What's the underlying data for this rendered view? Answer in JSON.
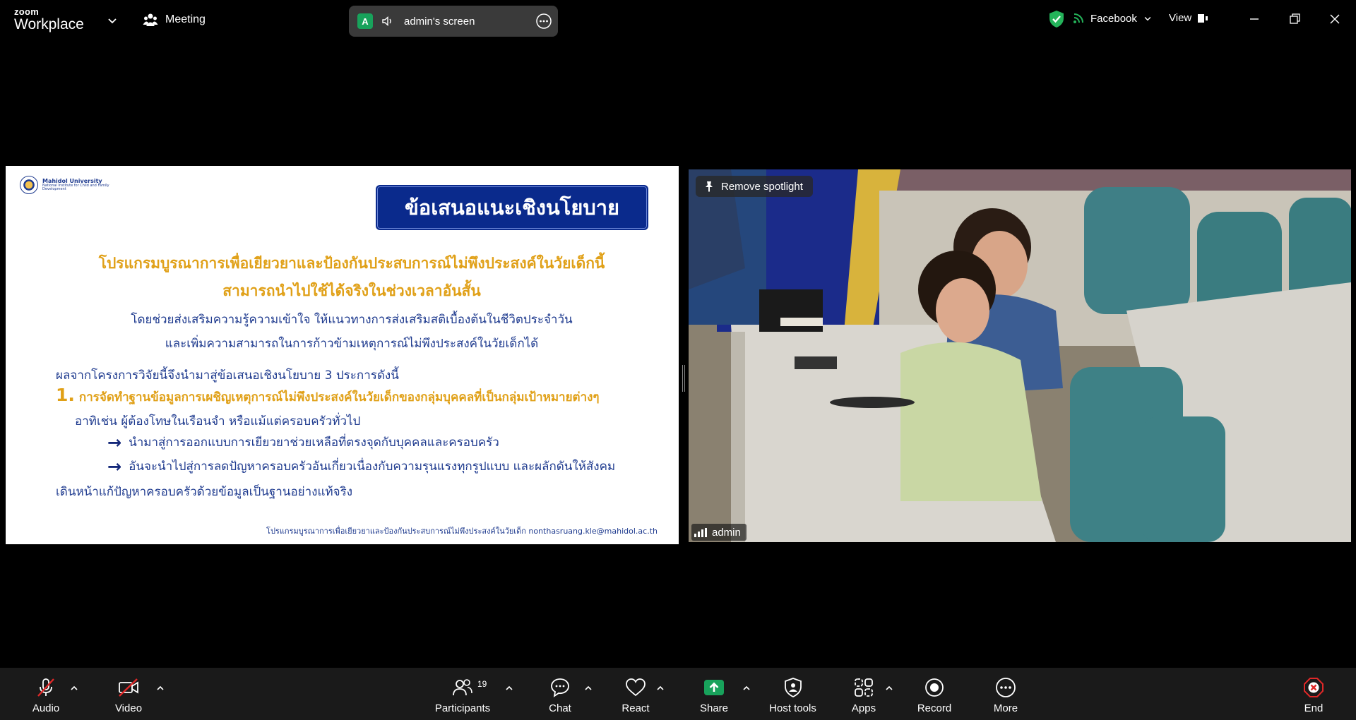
{
  "app": {
    "logo_small": "zoom",
    "logo_large": "Workplace",
    "meeting_label": "Meeting"
  },
  "share_indicator": {
    "avatar_letter": "A",
    "label": "admin's screen"
  },
  "top_right": {
    "feed_label": "Facebook",
    "view_label": "View"
  },
  "slide": {
    "university": "Mahidol University",
    "institute": "National Institute for Child and Family Development",
    "banner": "ข้อเสนอแนะเชิงนโยบาย",
    "heading_1": "โปรแกรมบูรณาการเพื่อเยียวยาและป้องกันประสบการณ์ไม่พึงประสงค์ในวัยเด็กนี้",
    "heading_2": "สามารถนำไปใช้ได้จริงในช่วงเวลาอันสั้น",
    "sub_1": "โดยช่วยส่งเสริมความรู้ความเข้าใจ  ให้แนวทางการส่งเสริมสติเบื้องต้นในชีวิตประจำวัน",
    "sub_2": "และเพิ่มความสามารถในการก้าวข้ามเหตุการณ์ไม่พึงประสงค์ในวัยเด็กได้",
    "intro": "ผลจากโครงการวิจัยนี้จึงนำมาสู่ข้อเสนอเชิงนโยบาย 3 ประการดังนี้",
    "item_number": "1.",
    "item_1": "การจัดทำฐานข้อมูลการเผชิญเหตุการณ์ไม่พึงประสงค์ในวัยเด็กของกลุ่มบุคคลที่เป็นกลุ่มเป้าหมายต่างๆ",
    "item_1_cont": "อาทิเช่น ผู้ต้องโทษในเรือนจำ หรือแม้แต่ครอบครัวทั่วไป",
    "arrow_1": "นำมาสู่การออกแบบการเยียวยาช่วยเหลือที่ตรงจุดกับบุคคลและครอบครัว",
    "arrow_2": "อันจะนำไปสู่การลดปัญหาครอบครัวอันเกี่ยวเนื่องกับความรุนแรงทุกรูปแบบ  และผลักดันให้สังคม",
    "arrow_2_cont": "เดินหน้าแก้ปัญหาครอบครัวด้วยข้อมูลเป็นฐานอย่างแท้จริง",
    "footer": "โปรแกรมบูรณาการเพื่อเยียวยาและป้องกันประสบการณ์ไม่พึงประสงค์ในวัยเด็ก nonthasruang.kle@mahidol.ac.th"
  },
  "video": {
    "spotlight_button": "Remove spotlight",
    "participant_name": "admin"
  },
  "toolbar": {
    "audio": "Audio",
    "video": "Video",
    "participants": "Participants",
    "participants_count": "19",
    "chat": "Chat",
    "react": "React",
    "share": "Share",
    "host_tools": "Host tools",
    "apps": "Apps",
    "record": "Record",
    "more": "More",
    "end": "End"
  },
  "colors": {
    "share_green": "#18a25b",
    "end_red": "#e02828",
    "slide_blue": "#1f3b8f",
    "slide_gold": "#e0a017",
    "banner_navy": "#0a2a8c"
  }
}
